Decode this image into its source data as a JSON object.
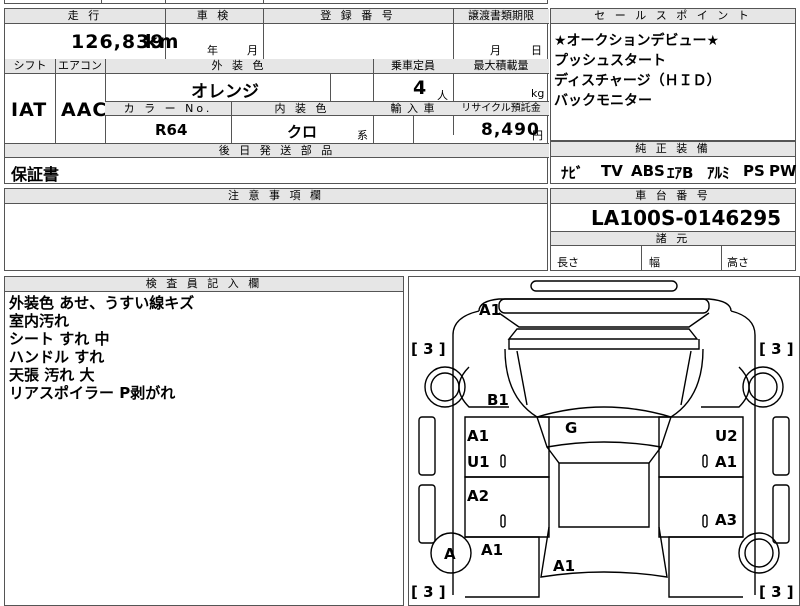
{
  "main_table": {
    "mileage_header": "走 行",
    "mileage_value": "126,839",
    "mileage_unit": "km",
    "inspection_header": "車 検",
    "inspection_year_unit": "年",
    "inspection_month_unit": "月",
    "registration_header": "登 録 番 号",
    "transfer_header": "譲渡書類期限",
    "transfer_month_unit": "月",
    "transfer_day_unit": "日",
    "shift_header": "シフト",
    "shift_value": "IAT",
    "aircon_header": "エアコン",
    "aircon_value": "AAC",
    "color_header": "外 装 色",
    "color_value": "オレンジ",
    "capacity_header": "乗車定員",
    "capacity_value": "4",
    "capacity_unit": "人",
    "max_load_header": "最大積載量",
    "max_load_unit": "kg",
    "color_no_header": "カ ラ ー  No.",
    "color_no_value": "R64",
    "interior_header": "内 装 色",
    "interior_value": "クロ",
    "interior_suffix": "系",
    "import_header": "輸 入 車",
    "recycle_header": "リサイクル預託金",
    "recycle_value": "8,490",
    "recycle_unit": "円",
    "later_items_header": "後 日 発 送 部 品",
    "later_items_value": "保証書"
  },
  "sales_points": {
    "header": "セ ー ル ス ポ イ ン ト",
    "lines": [
      "★オークションデビュー★",
      "プッシュスタート",
      "ディスチャージ（ＨＩＤ）",
      "バックモニター"
    ]
  },
  "equipment": {
    "header": "純 正 装 備",
    "items": [
      "ﾅﾋﾞ",
      "TV",
      "ABS",
      "ｴｱB",
      "ｱﾙﾐ",
      "PS",
      "PW"
    ]
  },
  "chassis": {
    "header": "車 台 番 号",
    "value": "LA100S-0146295"
  },
  "dimensions": {
    "header": "諸 元",
    "length_label": "長さ",
    "width_label": "幅",
    "height_label": "高さ"
  },
  "caution": {
    "header": "注 意 事 項 欄"
  },
  "inspector": {
    "header": "検 査 員 記 入 欄",
    "lines": [
      "外装色 あせ、うすい線キズ",
      "室内汚れ",
      "シート すれ 中",
      "ハンドル すれ",
      "天張 汚れ 大",
      "リアスポイラー P剥がれ"
    ]
  },
  "diagram": {
    "marks": {
      "front": "A1",
      "hood_left": "B1",
      "roof": "G",
      "left_front_door": "A1",
      "left_front_door_2": "U1",
      "left_rear_door": "A2",
      "left_rear_quarter": "A1",
      "left_rear_wheel": "A",
      "right_front_door": "U2",
      "right_front_door_2": "A1",
      "right_rear_door": "A3",
      "rear": "A1"
    },
    "tire_labels": {
      "front_left": "[ 3 ]",
      "front_right": "[ 3 ]",
      "rear_left": "[ 3 ]",
      "rear_right": "[ 3 ]"
    }
  }
}
